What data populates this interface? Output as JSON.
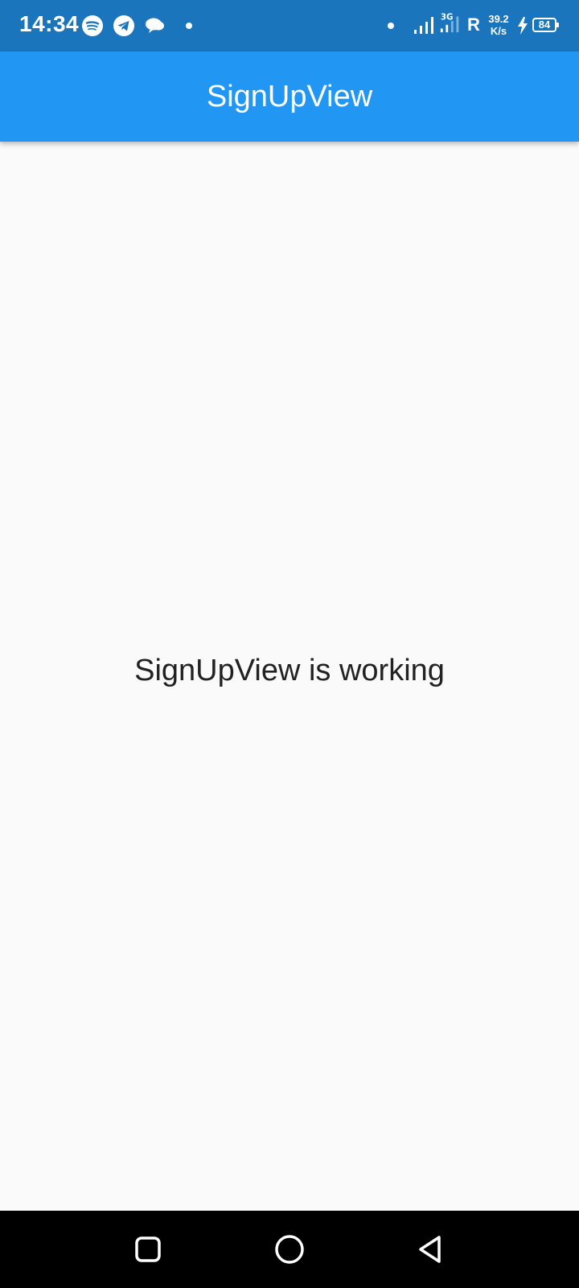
{
  "status_bar": {
    "time": "14:34",
    "network_letter": "R",
    "net_speed_value": "39.2",
    "net_speed_unit": "K/s",
    "battery_level": "84",
    "notification_icons": [
      "spotify-icon",
      "telegram-icon",
      "chat-bubble-icon"
    ],
    "system_icons": [
      "signal-icon",
      "wifi-signal-icon",
      "charging-icon",
      "battery-icon"
    ]
  },
  "app_bar": {
    "title": "SignUpView",
    "color": "#2196f3"
  },
  "body": {
    "message": "SignUpView is working"
  },
  "nav_bar": {
    "buttons": [
      "recents-icon",
      "home-icon",
      "back-icon"
    ]
  }
}
